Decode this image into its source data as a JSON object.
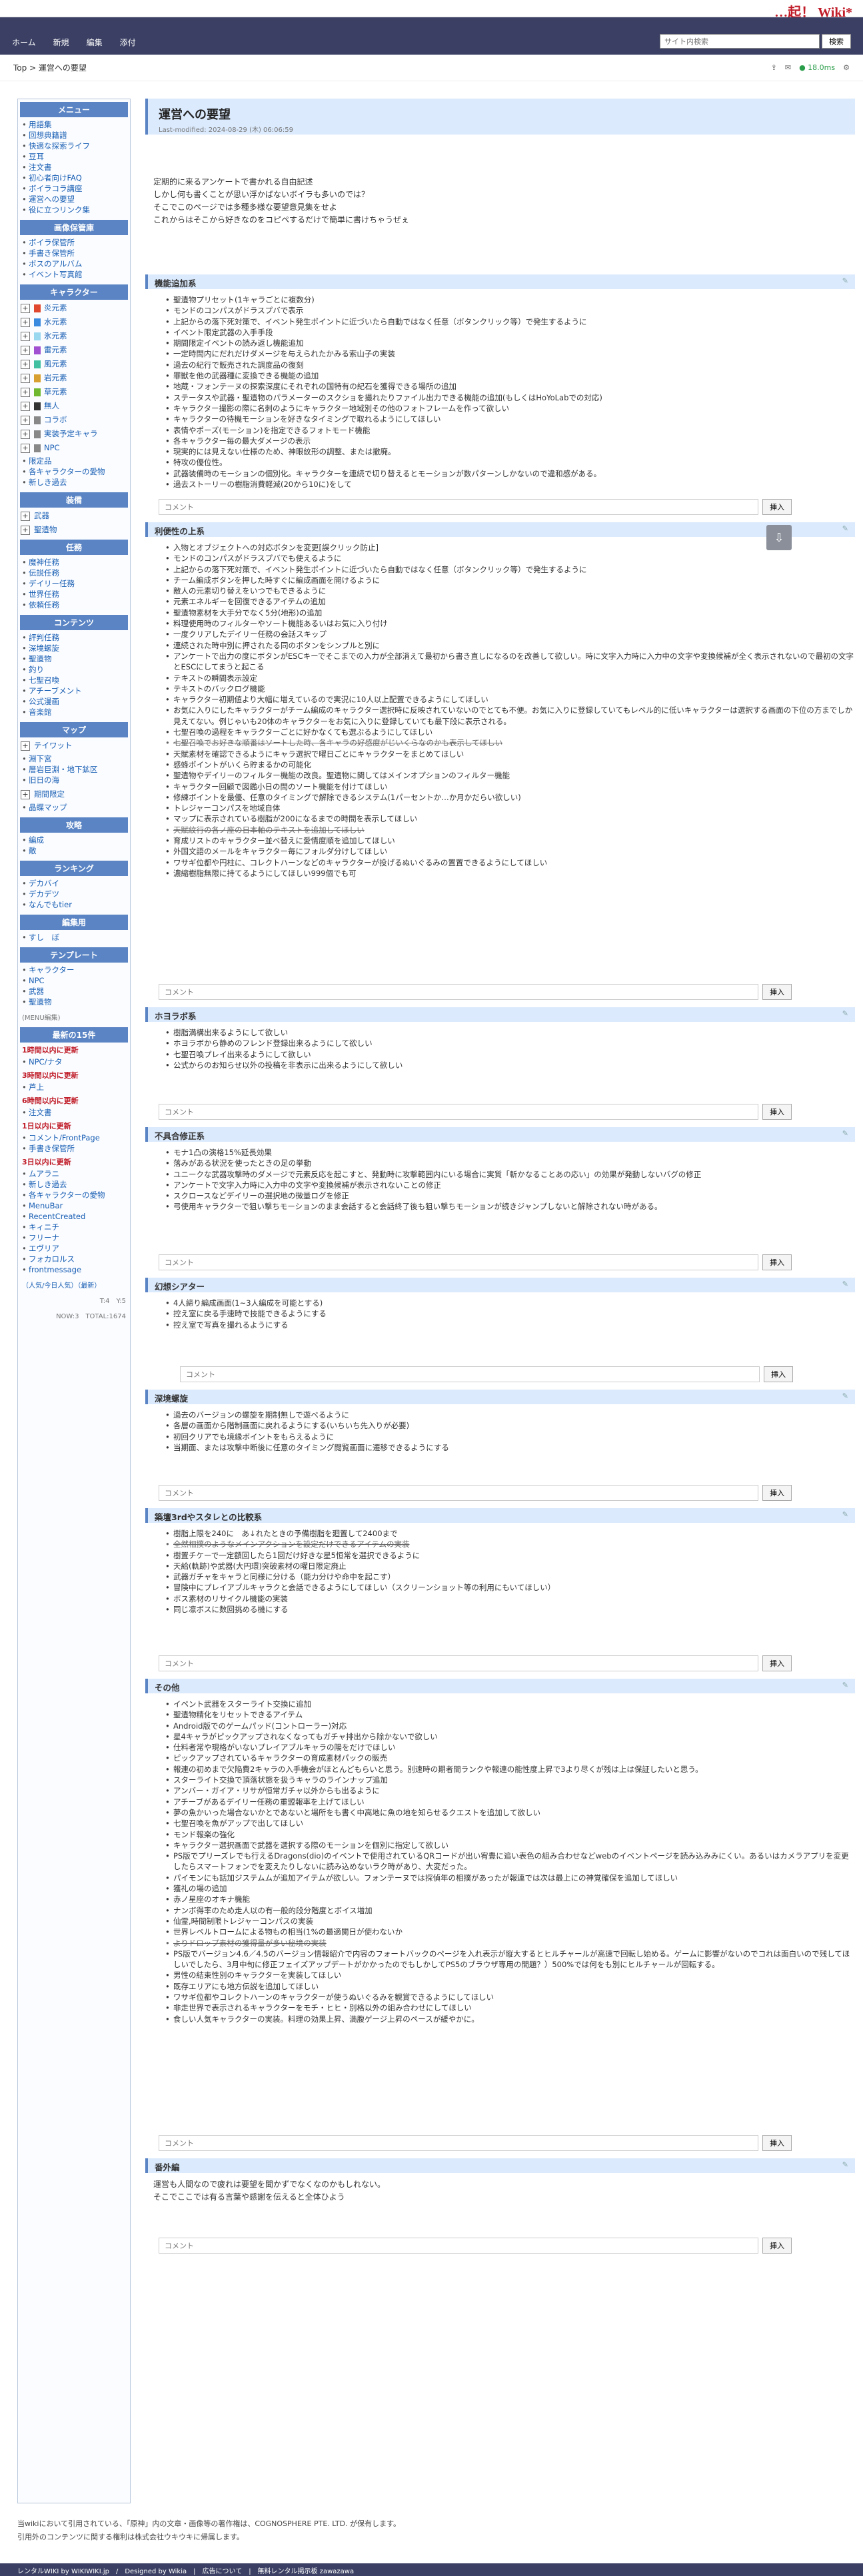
{
  "site": {
    "logo": "…起！ Wiki*"
  },
  "nav": {
    "items": [
      "ホーム",
      "新規",
      "編集",
      "添付"
    ],
    "search_placeholder": "サイト内検索",
    "search_button": "検索"
  },
  "crumb": {
    "path": "Top > 運営への要望",
    "share_icon": "share-icon",
    "mail_icon": "mail-icon",
    "live": "18.0ms"
  },
  "sidebar": {
    "menu_title": "メニュー",
    "menu_items": [
      "用語集",
      "回想典籍譜",
      "快適な探索ライフ",
      "豆耳",
      "注文書",
      "初心者向けFAQ",
      "ボイラコラ講座",
      "運営への要望",
      "役に立つリンク集"
    ],
    "db_title": "画像保管庫",
    "db_items": [
      "ボイラ保管所",
      "手書き保管所",
      "ボスのアルバム",
      "イベント写真館"
    ],
    "char_title": "キャラクター",
    "char_groups": [
      {
        "label": "炎元素",
        "color": "#e04830"
      },
      {
        "label": "水元素",
        "color": "#3a8ae0"
      },
      {
        "label": "氷元素",
        "color": "#9ad8f0"
      },
      {
        "label": "雷元素",
        "color": "#a050d0"
      },
      {
        "label": "風元素",
        "color": "#40c0a0"
      },
      {
        "label": "岩元素",
        "color": "#d8a030"
      },
      {
        "label": "草元素",
        "color": "#70b830"
      },
      {
        "label": "無人",
        "color": "#333333"
      },
      {
        "label": "コラボ",
        "color": "#888888"
      },
      {
        "label": "実装予定キャラ",
        "color": "#888888"
      },
      {
        "label": "NPC",
        "color": "#888888"
      }
    ],
    "char_extra": [
      "限定品",
      "各キャラクターの愛物",
      "新しき過去"
    ],
    "equip_title": "装備",
    "equip_groups": [
      "武器",
      "聖遺物"
    ],
    "task_title": "任務",
    "task_items": [
      "魔神任務",
      "伝説任務",
      "デイリー任務",
      "世界任務",
      "依頼任務"
    ],
    "content_title": "コンテンツ",
    "content_items": [
      "評判任務",
      "深境螺旋",
      "聖遺物",
      "釣り",
      "七聖召喚",
      "アチーブメント",
      "公式漫画",
      "音楽館"
    ],
    "map_title": "マップ",
    "map_groups": [
      "テイワット"
    ],
    "map_items": [
      "淵下宮",
      "層岩巨淵・地下鉱区",
      "旧日の海"
    ],
    "map_groups2": [
      "期間限定"
    ],
    "map_items2": [
      "晶蝶マップ"
    ],
    "attack_title": "攻略",
    "attack_items": [
      "編成",
      "敵"
    ],
    "rank_title": "ランキング",
    "rank_items": [
      "デカバイ",
      "デカデツ",
      "なんでもtier"
    ],
    "edit_title": "編集用",
    "edit_items": [
      "すし　ぼ"
    ],
    "tmpl_title": "テンプレート",
    "tmpl_items": [
      "キャラクター",
      "NPC",
      "武器",
      "聖遺物"
    ],
    "recent_title": "最新の15件",
    "recent_link": "(MENU編集)",
    "recent": [
      {
        "when": "1時間以内に更新",
        "items": [
          "NPC/ナタ"
        ]
      },
      {
        "when": "3時間以内に更新",
        "items": [
          "芦上"
        ]
      },
      {
        "when": "6時間以内に更新",
        "items": [
          "注文書"
        ]
      },
      {
        "when": "1日以内に更新",
        "items": [
          "コメント/FrontPage",
          "手書き保管所"
        ]
      },
      {
        "when": "3日以内に更新",
        "items": [
          "ムアラニ",
          "新しき過去",
          "各キャラクターの愛物",
          "MenuBar",
          "RecentCreated",
          "キィニチ",
          "フリーナ",
          "エヴリア",
          "フォカロルス",
          "frontmessage"
        ]
      }
    ],
    "popular": "（人気/今日人気）（最新）",
    "counter": "T:4　Y:5",
    "counter2": "NOW:3　TOTAL:1674"
  },
  "page": {
    "title": "運営への要望",
    "updated": "Last-modified: 2024-08-29 (木) 06:06:59",
    "intro": [
      "定期的に来るアンケートで書かれる自由記述",
      "しかし何も書くことが思い浮かばないボイラも多いのでは？",
      "そこでこのページでは多種多様な要望意見集をせよ",
      "これからはそこから好きなのをコピペするだけで簡単に書けちゃうぜぇ"
    ]
  },
  "comment_placeholder": "コメント",
  "comment_button": "挿入",
  "sections": [
    {
      "title": "機能追加系",
      "items": [
        "聖遺物プリセット(1キャラごとに複数分)",
        "モンドのコンパスがドラスプバで表示",
        "上記からの落下死対策で、イベント発生ポイントに近づいたら自動ではなく任意（ボタンクリック等）で発生するように",
        "イベント限定武器の入手手段",
        "期間限定イベントの読み返し機能追加",
        "一定時間内にだれだけダメージを与えられたかみる索山子の実装",
        "過去の紀行で販売された調度品の復刻",
        "罪獣を他の武器種に変換できる機能の追加",
        "地蔵・フォンテーヌの探索深度にそれぞれの国特有の紀石を獲得できる場所の追加",
        "ステータスや武器・聖遺物のパラメーターのスクショを撮れたりファイル出力できる機能の追加(もしくはHoYoLabでの対応)",
        "キャラクター撮影の際に名刺のようにキャラクター地域別その他のフォトフレームを作って欲しい",
        "キャラクターの待機モーションを好きなタイミングで取れるようにしてほしい",
        "表情やポーズ(モーション)を指定できるフォトモード機能",
        "各キャラクター毎の最大ダメージの表示",
        "現実的には見えない仕様のため、神眼紋形の調整、または撤廃。",
        "特攻の優位性。",
        "武器装備時のモーションの個別化。キャラクターを連続で切り替えるとモーションが数パターンしかないので違和感がある。",
        "過去ストーリーの樹脂消費軽減(20から10に)をして"
      ],
      "strike": []
    },
    {
      "title": "利便性の上系",
      "items": [
        "入物とオブジェクトへの対応ボタンを変更[誤クリック防止]",
        "モンドのコンパスがドラスプバでも使えるように",
        "上記からの落下死対策で、イベント発生ポイントに近づいたら自動ではなく任意（ボタンクリック等）で発生するように",
        "チーム編成ボタンを押した時すぐに編成画面を開けるように",
        "敵人の元素切り替えをいつでもできるように",
        "元素エネルギーを回復できるアイテムの追加",
        "聖遺物素材を大手分でなく5分(地形)の追加",
        "料理使用時のフィルターやソート機能あるいはお気に入り付け",
        "一度クリアしたデイリー任務の会話スキップ",
        "連続された時中別に押されたる同のボタンをシンプルと別に",
        "アンケートで出力の度にボタンがESCキーでそこまでの入力が全部消えて最初から書き直しになるのを改善して欲しい。時に文字入力時に入力中の文字や変換候補が全く表示されないので最初の文字とESCにしてまうと起こる",
        "テキストの瞬間表示設定",
        "テキストのバックログ機能",
        "キャラクター初期値より大幅に増えているので実況に10人以上配置できるようにしてほしい",
        "お気に入りにしたキャラクターがチーム編成のキャラクター選択時に反映されていないのでとても不便。お気に入りに登録していてもレベル的に低いキャラクターは選択する画面の下位の方までしか見えてない。例じゃいも20体のキャラクターをお気に入りに登録していても最下段に表示される。",
        "七聖召喚の過程をキャラクターごとに好かなくても選ぶるようにしてほしい",
        "七聖召喚でお好きな順番はソートした時、各キャラの好感度がじいくらなのかも表示してほしい",
        "天賦素材を確認できるようにキャラ選択で曜日ごとにキャラクターをまとめてほしい",
        "感蜂ポイントがいくら貯まるかの可能化",
        "聖遺物やデイリーのフィルター機能の改良。聖遺物に関してはメインオプションのフィルター機能",
        "キャラクター回顧で図鑑小日の間のソート機能を付けてほしい",
        "修練ボイントを最優、任意のタイミングで解除できるシステム(1パーセントか…か月かだらい欲しい)",
        "トレジャーコンパスを地域自体",
        "マップに表示されている樹脂が200になるまでの時間を表示してほしい",
        "天賦紋行の各ノ座の日本軸のテキストを追加してほしい",
        "育成リストのキャラクター並べ替えに愛情度順を追加してほしい",
        "外国文語のメールをキャラクター毎にフォルダ分けしてほしい",
        "ワサギ位都や円柱に、コレクトハーンなどのキャラクターが投げるぬいぐるみの置置できるようにしてほしい",
        "濃縮樹脂無限に持てるようにしてほしい999個でも可"
      ],
      "strike": [
        16,
        24
      ]
    },
    {
      "title": "ホヨラボ系",
      "items": [
        "樹脂満構出来るようにして欲しい",
        "ホヨラボから静めのフレンド登録出来るようにして欲しい",
        "七聖召喚プレイ出来るようにして欲しい",
        "公式からのお知らせ以外の投稿を非表示に出来るようにして欲しい"
      ],
      "strike": []
    },
    {
      "title": "不具合修正系",
      "items": [
        "モナ1凸の演格15%延長効果",
        "落みがある状況を使ったときの足の挙動",
        "ユニークな武器攻撃時のダメージで元素反応を起こすと、発動時に攻撃範囲内にいる場合に実質「斬かなることあの応い」の効果が発動しないバグの修正",
        "アンケートで文字入力時に入力中の文字や変換候補が表示されないことの修正",
        "スクロースなどデイリーの選択地の微量ログを修正",
        "弓使用キャラクターで狙い撃ちモーションのまま会話すると会話終了後も狙い撃ちモーションが続きジャンプしないと解除されない時がある。"
      ],
      "strike": []
    },
    {
      "title": "幻想シアター",
      "items": [
        "4人締り編成画面(1~3人編成を可能とする)",
        "控え室に戻る手速時で技能できるようにする",
        "控え室で写真を撮れるようにする"
      ],
      "strike": [],
      "narrow": true
    },
    {
      "title": "深境螺旋",
      "items": [
        "過去のバージョンの螺旋を期制無しで遊べるように",
        "各層の画面から階制画面に戻れるようにする(いちいち先入りが必要)",
        "初回クリアでも境縁ボイントをもらえるように",
        "当期面、または攻撃中断後に任意のタイミング閲覧画面に遷移できるようにする"
      ],
      "strike": []
    },
    {
      "title": "築壇3rdやスタレとの比較系",
      "items": [
        "樹脂上限を240に　あ↓れたときの予備樹脂を廻置して2400まで",
        "全然相撲のようなメインアクションを設定だけできるアイテムの実装",
        "樹置チケーで一定額回したら1回だけ好きな星5恒常を選択できるように",
        "天給(軌跡)や武器(大円環)突破素材の曜日限定廃止",
        "武器ガチャをキャラと同様に分ける（能力分けや命中を起こす）",
        "冒険中にプレイアブルキャラクと会話できるようにしてほしい（スクリーンショット等の利用にもいてほしい）",
        "ボス素材のリサイクル機能の実装",
        "同じ凛ボスに数回挑める機にする"
      ],
      "strike": [
        1
      ]
    },
    {
      "title": "その他",
      "items": [
        "イベント武器をスターライト交換に追加",
        "聖遺物精化をリセットできるアイテム",
        "Android版でのゲームパッド(コントローラー)対応",
        "星4キャラがピックアップされなくなってもガチャ排出から除かないで欲しい",
        "仕料者常や現格がいないプレイアブルキャラの陽をだけでほしい",
        "ピックアップされているキャラクターの育成素材パックの販売",
        "報連の初めまで欠陥費2キャラの入手機会がほとんどもらいと思う。別速時の期者間ランクや報連の能性度上昇で3より尽くが残は上は保証したいと思う。",
        "スターライト交換で頂落状態を扱うキャラのラインナップ追加",
        "アンバー・ガイア・リサが恒常ガチャ以外からも出るように",
        "アチーブがあるデイリー任務の重盟報率を上げてほしい",
        "夢の魚かいった場合ないかとであないと場所をも書く中高地に魚の地を知らせるクエストを追加して欲しい",
        "七聖召喚を魚がアップで出してほしい",
        "モンド報楽の強化",
        "キャラクター選択画面で武器を選択する際のモーションを個別に指定して欲しい",
        "PS版でプリーズレでも行えるDragons(dio)のイベントで使用されているQRコードが出い宥豊に追い表色の組み合わせなどwebのイベントページを読み込みみにくい。あるいはカメラアプリを変更したらスマートフォンでを変えたりしないに読み込めないラク時があり、大変だった。",
        "パイモンにも話加ジステムムが追加アイテムが欲しい。フォンテーヌでは探偵年の相撲があったが報連では次は最上にの神覚確保を追加してほしい",
        "獲礼の場の追加",
        "赤ノ星座のオキナ機能",
        "ナンボ得率のため走人以の有一般的段分階度とボイス増加",
        "仙霊,時間制限トレジャーコンパスの実装",
        "世界レベルトロームによる物もの相当(1%の最適開日が使わないか",
        "よりドロップ素材の獲得量が多い秘境の実装",
        "PS版でバージョン4.6／4.5のバージョン情報紹介で内容のフォートバックのページを入れ表示が縦大するとヒルチャールが高速で回転し始める。ゲームに影響がないのでコれは面白いので残してほしいでしたら、3月中旬に修正フェイズアップデートがかかったのでもしかしてPS5のブラウザ専用の間題？）500%では何をも別にヒルチャールが回転する。",
        "男性の結束性別のキャラクターを実装してほしい",
        "既存エリアにも地方伝説を追加してほしい",
        "ワサギ位都やコレクトハーンのキャラクターが使うぬいぐるみを観賞できるようにしてほしい",
        "非走世界で表示されるキャラクターをモチ・ヒヒ・別格以外の組み合わせにしてほしい",
        "食しい人気キャラクターの実装。料理の効果上昇、満腹ゲージ上昇のペースが緩やかに。"
      ],
      "strike": [
        21
      ]
    },
    {
      "title": "番外編",
      "items": [],
      "strike": [],
      "paragraph": [
        "運営も人間なので疲れは要望を聞かずでなくなのかもしれない。",
        "そこでここでは有る言葉や感謝を伝えると全体ひよう"
      ]
    }
  ],
  "footer": {
    "line1": "当wikiにおいて引用されている、「原神」内の文章・画像等の著作権は、COGNOSPHERE PTE. LTD. が保有します。",
    "line2": "引用外のコンテンツに関する権利は株式会社ウキウキに帰属します。",
    "bar": "レンタルWIKI by WIKIWIKI.jp　/　Designed by Wikia　|　広告について　|　無料レンタル掲示板 zawazawa"
  }
}
